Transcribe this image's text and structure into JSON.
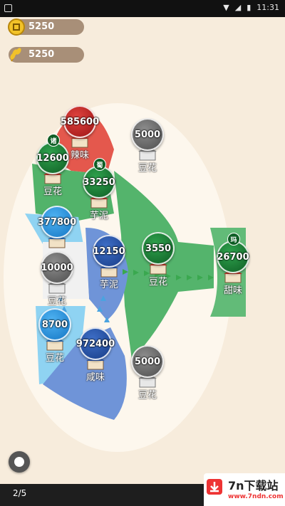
{
  "status_bar": {
    "time": "11:31"
  },
  "resources": [
    {
      "icon": "coin-icon",
      "value": "5250"
    },
    {
      "icon": "wheat-icon",
      "value": "5250"
    }
  ],
  "nodes": [
    {
      "id": "n1",
      "troops": "585600",
      "team": "red",
      "label": "辣味",
      "tag": ""
    },
    {
      "id": "n2",
      "troops": "12600",
      "team": "green",
      "label": "豆花",
      "tag": "诸"
    },
    {
      "id": "n3",
      "troops": "33250",
      "team": "green",
      "label": "芋泥",
      "tag": "蜀"
    },
    {
      "id": "n4",
      "troops": "377800",
      "team": "blue",
      "label": "",
      "tag": ""
    },
    {
      "id": "n5",
      "troops": "12150",
      "team": "darkblue",
      "label": "芋泥",
      "tag": ""
    },
    {
      "id": "n6",
      "troops": "10000",
      "team": "gray",
      "label": "豆花",
      "tag": ""
    },
    {
      "id": "n7",
      "troops": "3550",
      "team": "green",
      "label": "豆花",
      "tag": ""
    },
    {
      "id": "n8",
      "troops": "26700",
      "team": "green",
      "label": "甜味",
      "tag": "玛"
    },
    {
      "id": "n9",
      "troops": "8700",
      "team": "blue",
      "label": "豆花",
      "tag": ""
    },
    {
      "id": "n10",
      "troops": "972400",
      "team": "darkblue",
      "label": "咸味",
      "tag": ""
    },
    {
      "id": "n11",
      "troops": "5000",
      "team": "gray",
      "label": "豆花",
      "tag": ""
    },
    {
      "id": "n12",
      "troops": "5000",
      "team": "gray",
      "label": "豆花",
      "tag": ""
    }
  ],
  "pager": {
    "text": "2/5"
  },
  "watermark": {
    "title": "7n下载站",
    "url": "www.7ndn.com"
  },
  "colors": {
    "red": "#d93a36",
    "green": "#2f9a47",
    "blue": "#3aa6ea",
    "darkblue": "#2d5cb8",
    "gray": "#6f6f6f",
    "background": "#f7ecdc"
  }
}
